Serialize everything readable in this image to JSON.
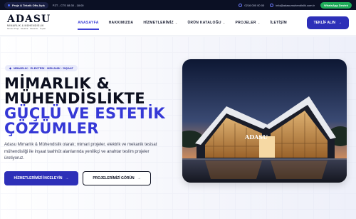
{
  "topbar": {
    "badge": "Proje & Teknik Ofis Açık",
    "hours": "PZT - CTS 08:30 - 18:00",
    "phone": "0216 000 00 00",
    "email": "info@adasumuhendislik.com.tr",
    "whatsapp": "WhatsApp Destek"
  },
  "brand": {
    "name": "ADASU",
    "subtitle": "MİMARLIK & MÜHENDİSLİK",
    "tagline": "Mimari Proje · Elektrik · Mekanik · İnşaat"
  },
  "nav": {
    "items": [
      {
        "label": "ANASAYFA",
        "active": true,
        "dropdown": false
      },
      {
        "label": "HAKKIMIZDA",
        "active": false,
        "dropdown": false
      },
      {
        "label": "HİZMETLERİMİZ",
        "active": false,
        "dropdown": true
      },
      {
        "label": "ÜRÜN KATALOĞU",
        "active": false,
        "dropdown": true
      },
      {
        "label": "PROJELER",
        "active": false,
        "dropdown": true
      },
      {
        "label": "İLETİŞİM",
        "active": false,
        "dropdown": false
      }
    ],
    "cta": "TEKLİF ALIN"
  },
  "hero": {
    "tag": "MİMARLIK · ELEKTRİK · MEKANİK · İNŞAAT",
    "title_line1": "MİMARLIK &",
    "title_line2": "MÜHENDİSLİKTE",
    "title_line3": "GÜÇLÜ VE ESTETİK",
    "title_line4": "ÇÖZÜMLER",
    "lead": "Adasu Mimarlık & Mühendislik olarak; mimari projeler, elektrik ve mekanik tesisat mühendisliği ile inşaat taahhüt alanlarında yenilikçi ve anahtar teslim projeler üretiyoruz.",
    "primary_button": "HİZMETLERİMİZİ İNCELEYİN",
    "secondary_button": "PROJELERİMİZİ GÖRÜN",
    "image_sign": "ADASU"
  },
  "colors": {
    "primary": "#2d2fb8",
    "accent": "#3538d6",
    "dark": "#0b1024",
    "whatsapp": "#1faa59"
  },
  "icons": {
    "arrow": "→",
    "chevron": "⌄"
  }
}
